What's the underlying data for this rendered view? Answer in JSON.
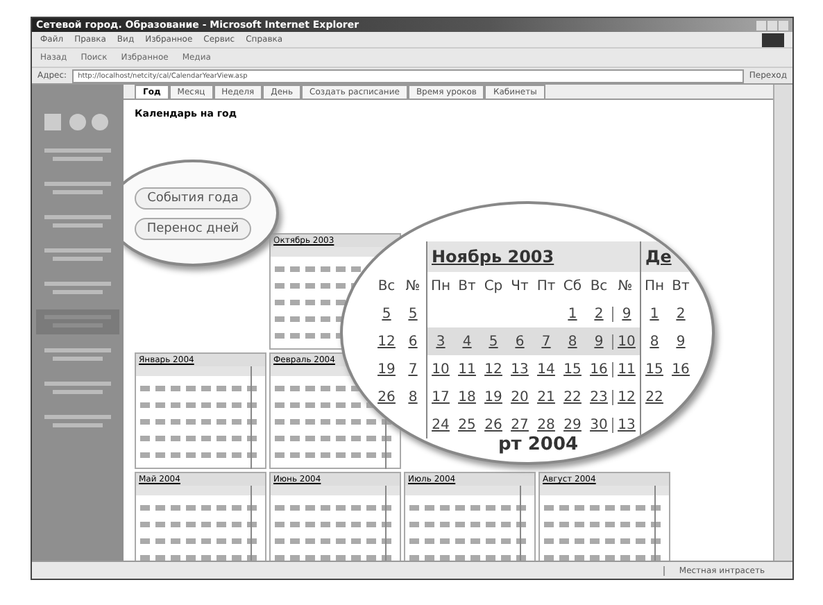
{
  "window": {
    "title": "Сетевой город. Образование - Microsoft Internet Explorer"
  },
  "menu": [
    "Файл",
    "Правка",
    "Вид",
    "Избранное",
    "Сервис",
    "Справка"
  ],
  "toolbar": [
    "Назад",
    "Поиск",
    "Избранное",
    "Медиа"
  ],
  "address": {
    "label": "Адрес:",
    "url": "http://localhost/netcity/cal/CalendarYearView.asp",
    "go": "Переход"
  },
  "tabs": [
    {
      "label": "Год",
      "selected": true
    },
    {
      "label": "Месяц",
      "selected": false
    },
    {
      "label": "Неделя",
      "selected": false
    },
    {
      "label": "День",
      "selected": false
    },
    {
      "label": "Создать расписание",
      "selected": false
    },
    {
      "label": "Время уроков",
      "selected": false
    },
    {
      "label": "Кабинеты",
      "selected": false
    }
  ],
  "heading": "Календарь на год",
  "callout_buttons": [
    "События года",
    "Перенос дней"
  ],
  "months": [
    "Октябрь 2003",
    "Январь 2004",
    "Февраль 2004",
    "Май 2004",
    "Июнь 2004",
    "Июль 2004",
    "Август 2004"
  ],
  "magnifier": {
    "prev_columns": [
      "Вс",
      "№"
    ],
    "prev_rows": [
      [
        "5",
        "5"
      ],
      [
        "12",
        "6"
      ],
      [
        "19",
        "7"
      ],
      [
        "26",
        "8"
      ]
    ],
    "title": "Ноябрь 2003",
    "weekdays": [
      "Пн",
      "Вт",
      "Ср",
      "Чт",
      "Пт",
      "Сб",
      "Вс",
      "№"
    ],
    "weeks": [
      {
        "days": [
          "1",
          "2"
        ],
        "week": "9"
      },
      {
        "days": [
          "3",
          "4",
          "5",
          "6",
          "7",
          "8",
          "9"
        ],
        "week": "10"
      },
      {
        "days": [
          "10",
          "11",
          "12",
          "13",
          "14",
          "15",
          "16"
        ],
        "week": "11"
      },
      {
        "days": [
          "17",
          "18",
          "19",
          "20",
          "21",
          "22",
          "23"
        ],
        "week": "12"
      },
      {
        "days": [
          "24",
          "25",
          "26",
          "27",
          "28",
          "29",
          "30"
        ],
        "week": "13"
      }
    ],
    "next_title": "Де",
    "next_weekdays": [
      "Пн",
      "Вт"
    ],
    "next_rows": [
      [
        "1",
        "2"
      ],
      [
        "8",
        "9"
      ],
      [
        "15",
        "16"
      ],
      [
        "22"
      ]
    ],
    "below_title": "рт 2004"
  },
  "status": "Местная интрасеть"
}
